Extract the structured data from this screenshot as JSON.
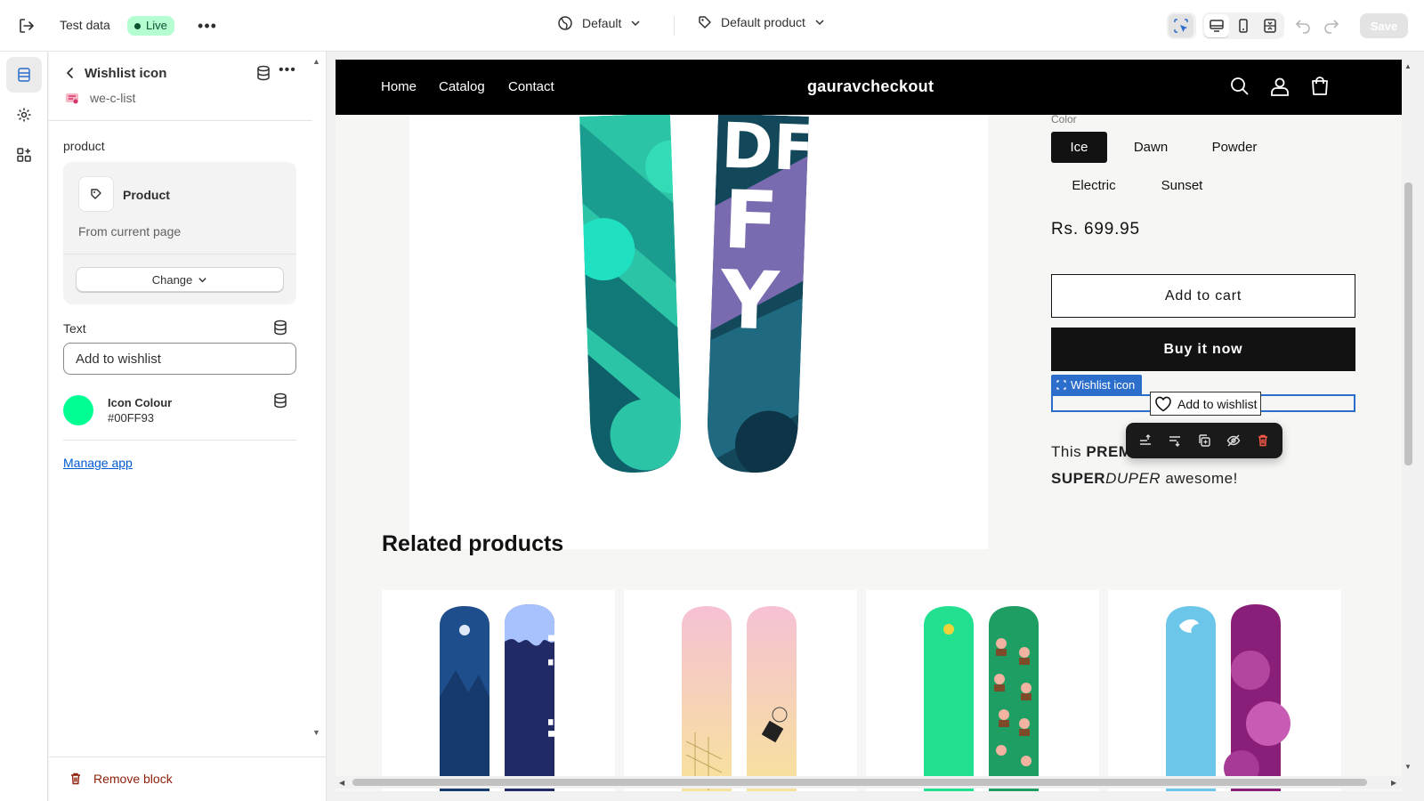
{
  "topbar": {
    "title": "Test data",
    "live_label": "Live",
    "more_label": "•••",
    "theme_label": "Default",
    "product_label": "Default product",
    "save_label": "Save"
  },
  "panel": {
    "title": "Wishlist icon",
    "more_label": "•••",
    "app_name": "we-c-list",
    "product_section_label": "product",
    "product_name": "Product",
    "product_source": "From current page",
    "change_label": "Change",
    "text_label": "Text",
    "text_value": "Add to wishlist",
    "color_label": "Icon Colour",
    "color_hex": "#00FF93",
    "manage_link": "Manage app",
    "remove_label": "Remove block"
  },
  "store": {
    "nav": [
      "Home",
      "Catalog",
      "Contact"
    ],
    "name": "gauravcheckout",
    "variant_label": "Color",
    "variants": [
      "Ice",
      "Dawn",
      "Powder",
      "Electric",
      "Sunset"
    ],
    "selected_variant": "Ice",
    "price": "Rs. 699.95",
    "add_to_cart": "Add to cart",
    "buy_now": "Buy it now",
    "block_tag": "Wishlist icon",
    "wishlist_label": "Add to wishlist",
    "desc_prefix": "This ",
    "desc_bold1": "PREM",
    "desc_bold2": "SUPER",
    "desc_italic": "DUPER",
    "desc_suffix": " awesome!",
    "related_title": "Related products"
  },
  "colors": {
    "accent": "#2c6ecb",
    "icon_colour": "#00FF93",
    "live_badge": "#b4fed2",
    "danger": "#e51c00"
  }
}
